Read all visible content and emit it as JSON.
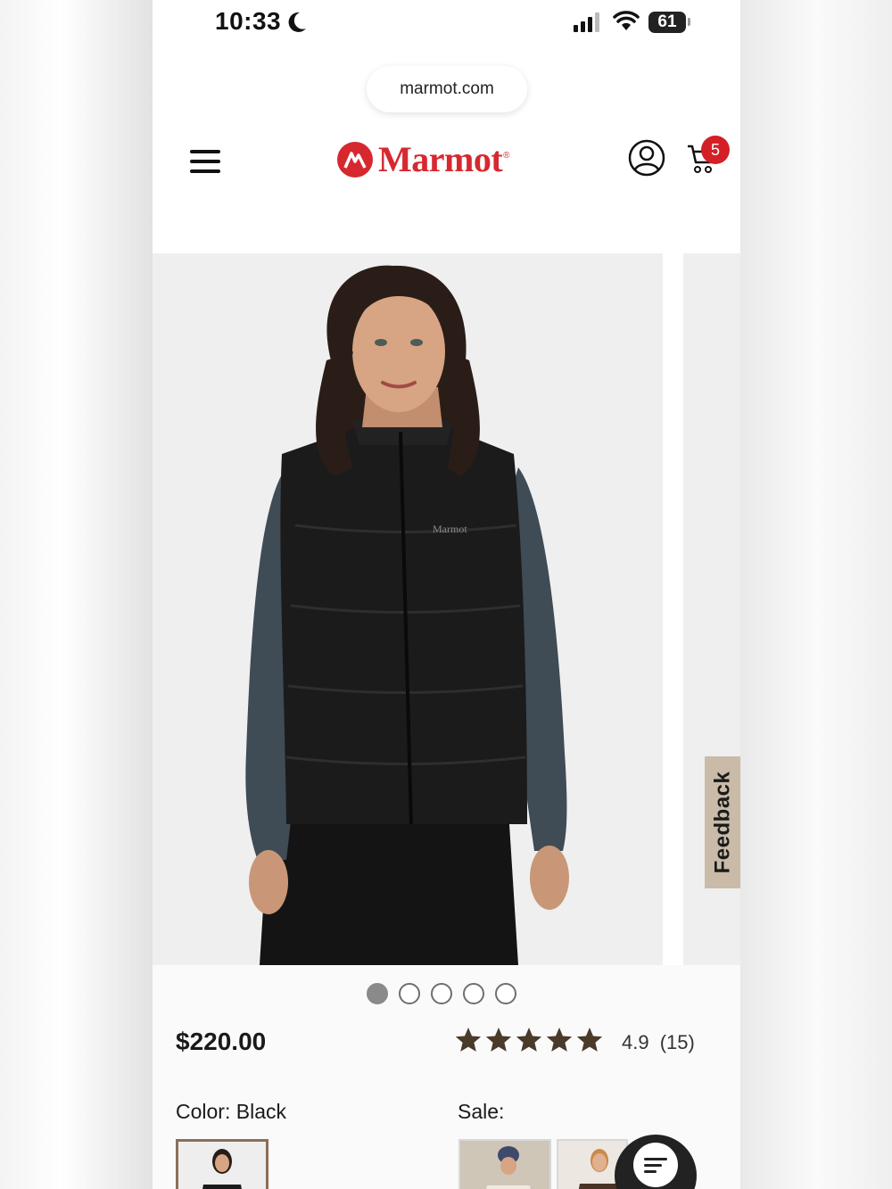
{
  "status_bar": {
    "time": "10:33",
    "battery": "61",
    "icons": [
      "moon-icon",
      "signal-icon",
      "wifi-icon",
      "battery-icon"
    ]
  },
  "browser": {
    "url": "marmot.com"
  },
  "header": {
    "brand": "Marmot",
    "brand_mark": "®",
    "cart_count": "5",
    "icons": [
      "menu-icon",
      "account-icon",
      "cart-icon"
    ]
  },
  "gallery": {
    "image_alt": "Woman wearing black Marmot down vest",
    "vest_logo": "Marmot",
    "dot_count": 5,
    "active_dot": 1
  },
  "product": {
    "price": "$220.00",
    "rating": "4.9",
    "review_count": "(15)",
    "stars_filled": 5,
    "color_label": "Color: Black",
    "sale_label": "Sale:"
  },
  "feedback": {
    "label": "Feedback"
  },
  "colors": {
    "brand_red": "#d7282f",
    "badge_red": "#d41f26",
    "star_brown": "#4a3a2a",
    "feedback_tan": "#c9bba8",
    "selected_border": "#8b6f58"
  }
}
